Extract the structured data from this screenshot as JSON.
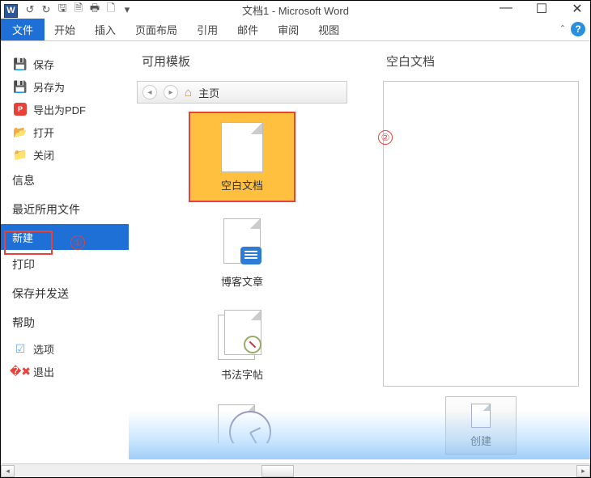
{
  "title": "文档1 - Microsoft Word",
  "app_icon_letter": "W",
  "tabs": {
    "file": "文件",
    "items": [
      "开始",
      "插入",
      "页面布局",
      "引用",
      "邮件",
      "审阅",
      "视图"
    ]
  },
  "sidebar": {
    "save": "保存",
    "saveas": "另存为",
    "pdf": "导出为PDF",
    "open": "打开",
    "close": "关闭",
    "info": "信息",
    "recent": "最近所用文件",
    "new": "新建",
    "print": "打印",
    "send": "保存并发送",
    "help": "帮助",
    "options": "选项",
    "exit": "退出"
  },
  "annotation": {
    "one": "①",
    "two": "②"
  },
  "templates": {
    "heading": "可用模板",
    "breadcrumb": "主页",
    "items": [
      "空白文档",
      "博客文章",
      "书法字帖"
    ],
    "selected": "空白文档"
  },
  "preview": {
    "heading": "空白文档",
    "create": "创建"
  },
  "pdf_badge": "P"
}
